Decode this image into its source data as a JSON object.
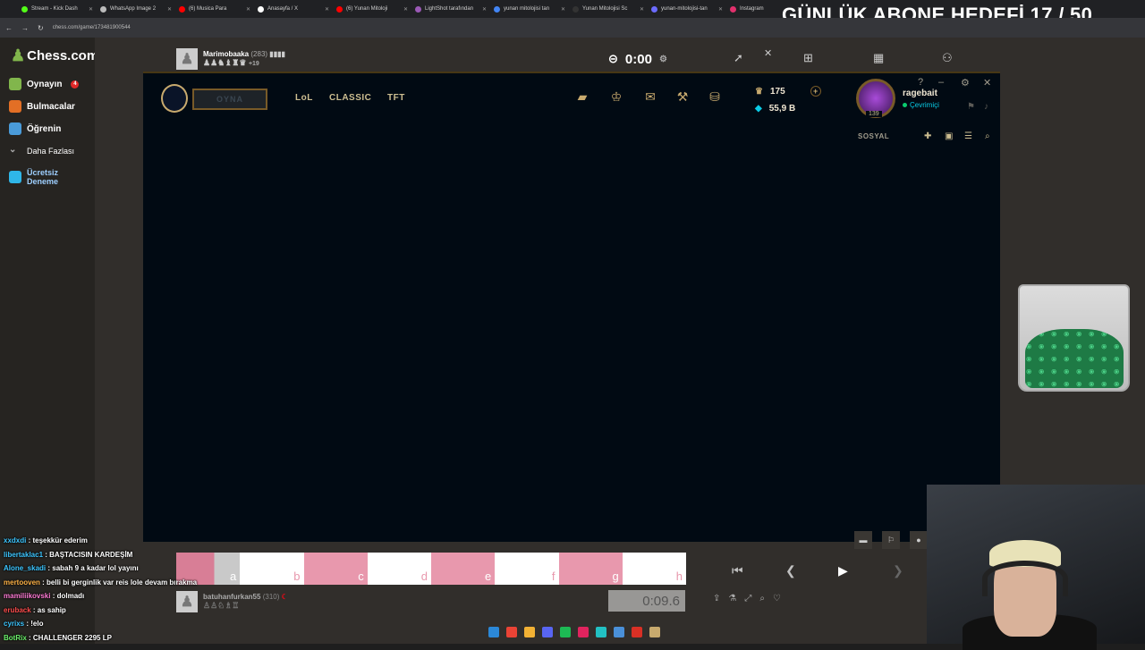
{
  "browser": {
    "tabs": [
      {
        "label": "Stream - Kick Dash",
        "icon": "kick-icon",
        "color": "#53fc18"
      },
      {
        "label": "WhatsApp Image 2",
        "icon": "globe-icon",
        "color": "#bbbbbb"
      },
      {
        "label": "(6) Musica Para",
        "icon": "youtube-icon",
        "color": "#ff0000"
      },
      {
        "label": "Anasayfa / X",
        "icon": "x-icon",
        "color": "#ffffff"
      },
      {
        "label": "(6) Yunan Mitoloji",
        "icon": "youtube-icon",
        "color": "#ff0000"
      },
      {
        "label": "LightShot tarafından",
        "icon": "feather-icon",
        "color": "#9b59b6"
      },
      {
        "label": "yunan mitolojisi tan",
        "icon": "google-icon",
        "color": "#4285f4"
      },
      {
        "label": "Yunan Mitolojisi Sc",
        "icon": "globe-icon",
        "color": "#333333"
      },
      {
        "label": "yunan-mitolojisi-tan",
        "icon": "globe-icon",
        "color": "#6b6bff"
      },
      {
        "label": "Instagram",
        "icon": "instagram-icon",
        "color": "#e1306c"
      }
    ],
    "url": "chess.com/game/173481900544"
  },
  "overlay": {
    "goal_text": "GÜNLÜK ABONE HEDEFİ 17 / 50"
  },
  "chesscom": {
    "logo": "Chess.com",
    "nav": [
      {
        "label": "Oynayın",
        "icon": "play-icon",
        "color": "#81b64c",
        "badge": "4"
      },
      {
        "label": "Bulmacalar",
        "icon": "puzzle-icon",
        "color": "#e36f25"
      },
      {
        "label": "Öğrenin",
        "icon": "learn-icon",
        "color": "#4a9bd9"
      },
      {
        "label": "Daha Fazlası",
        "icon": "chevron-down-icon",
        "color": "#aaaaaa"
      },
      {
        "label": "Ücretsiz Deneme",
        "icon": "diamond-icon",
        "color": "#2fb6e8"
      }
    ],
    "top_player": {
      "name": "Marimobaaka",
      "rating": "(283)",
      "extra": "+19"
    },
    "top_clock": "0:00",
    "bottom_player": {
      "name": "batuhanfurkan55",
      "rating": "(310)"
    },
    "bottom_clock": "0:09.6",
    "files": [
      "a",
      "b",
      "c",
      "d",
      "e",
      "f",
      "g",
      "h"
    ]
  },
  "lol": {
    "play_label": "OYNA",
    "nav": [
      "LoL",
      "CLASSIC",
      "TFT"
    ],
    "currency_rp": "175",
    "currency_be": "55,9 B",
    "username": "ragebait",
    "status": "Çevrimiçi",
    "level": "139",
    "social_label": "SOSYAL"
  },
  "chat": [
    {
      "user": "xxdxdi",
      "msg": "teşekkür ederim",
      "color": "#3dc6ff"
    },
    {
      "user": "libertaklac1",
      "msg": "BAŞTACISIN KARDEŞİM",
      "color": "#3dc6ff"
    },
    {
      "user": "Alone_skadi",
      "msg": "sabah 9 a kadar lol yayını",
      "color": "#3dc6ff"
    },
    {
      "user": "mertooven",
      "msg": "belli bi gerginlik var reis lole devam bırakma",
      "color": "#ffb347"
    },
    {
      "user": "mamiliikovski",
      "msg": "dolmadı",
      "color": "#ff7bd5"
    },
    {
      "user": "eruback",
      "msg": "as sahip",
      "color": "#ff4d4d"
    },
    {
      "user": "cyrixs",
      "msg": "!elo",
      "color": "#3dc6ff"
    },
    {
      "user": "BotRix",
      "msg": "CHALLENGER 2295 LP",
      "color": "#6cf06c"
    }
  ]
}
